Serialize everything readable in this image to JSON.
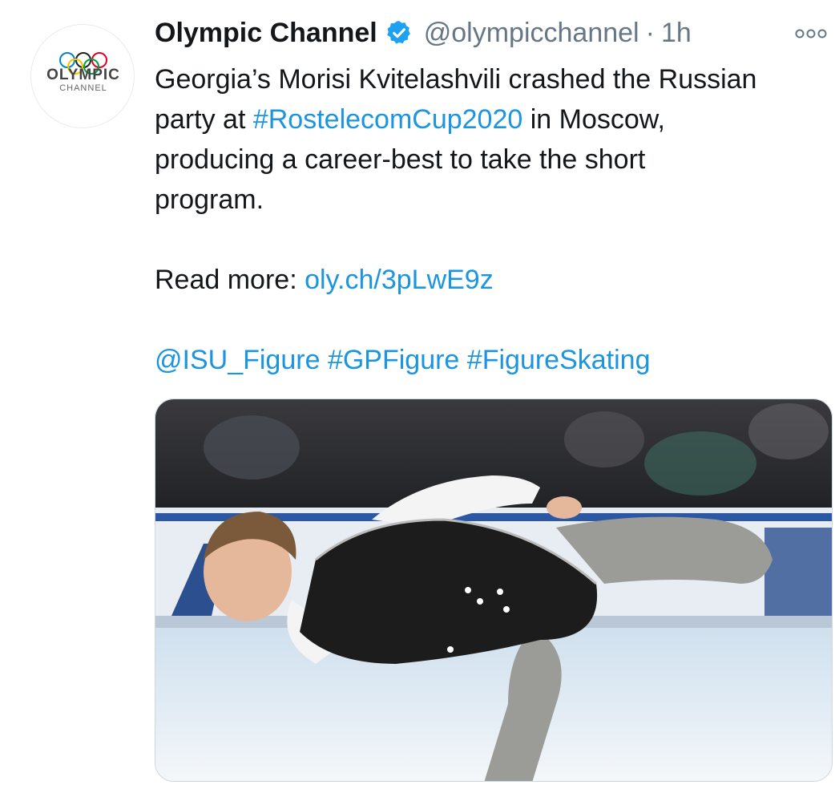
{
  "tweet": {
    "author": {
      "display_name": "Olympic Channel",
      "handle": "@olympicchannel",
      "verified": true,
      "avatar": {
        "logo_text": "OLYMPIC",
        "logo_subtext": "CHANNEL"
      }
    },
    "time_separator": "·",
    "time": "1h",
    "more_icon": "more-dots-icon",
    "text": {
      "line1": "Georgia’s Morisi Kvitelashvili crashed the Russian",
      "line2_prefix": "party at ",
      "hashtag_rostelecom": "#RostelecomCup2020",
      "line2_suffix": " in Moscow,",
      "line3": "producing a career-best to take the short",
      "line4": "program.",
      "read_more_label": "Read more: ",
      "link": "oly.ch/3pLwE9z",
      "mention": "@ISU_Figure",
      "hashtag_gp": "#GPFigure",
      "hashtag_fs": "#FigureSkating"
    },
    "colors": {
      "link": "#1b95e0",
      "text": "#14171a",
      "secondary": "#657786",
      "verified": "#1da1f2"
    }
  }
}
